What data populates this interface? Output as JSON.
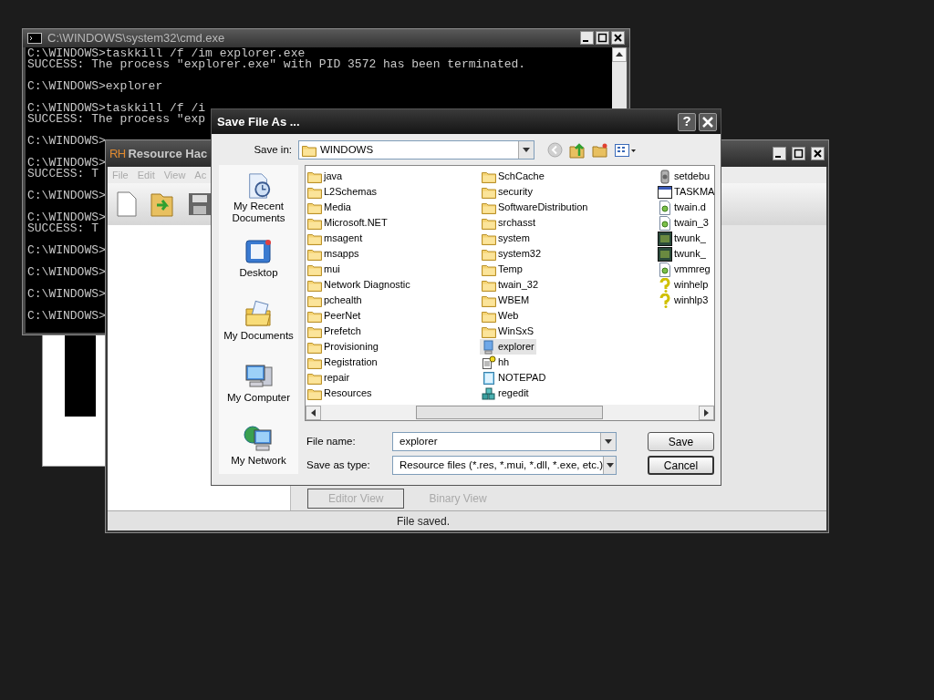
{
  "cmd_window": {
    "title": "C:\\WINDOWS\\system32\\cmd.exe",
    "blocks": [
      [
        "C:\\WINDOWS>taskkill /f /im explorer.exe",
        "SUCCESS: The process \"explorer.exe\" with PID 3572 has been terminated."
      ],
      [
        "C:\\WINDOWS>explorer"
      ],
      [
        "C:\\WINDOWS>taskkill /f /i",
        "SUCCESS: The process \"exp"
      ],
      [
        "C:\\WINDOWS>"
      ],
      [
        "C:\\WINDOWS>",
        "SUCCESS: T"
      ],
      [
        "C:\\WINDOWS>"
      ],
      [
        "C:\\WINDOWS>",
        "SUCCESS: T"
      ],
      [
        "C:\\WINDOWS>"
      ],
      [
        "C:\\WINDOWS>"
      ],
      [
        "C:\\WINDOWS>"
      ],
      [
        "C:\\WINDOWS>"
      ]
    ]
  },
  "resource_hacker": {
    "logo": "RH",
    "title": "Resource Hac",
    "menu": [
      "File",
      "Edit",
      "View",
      "Ac"
    ],
    "tabs": [
      {
        "label": "Editor View",
        "selected": true
      },
      {
        "label": "Binary View",
        "selected": false
      }
    ],
    "status": "File saved."
  },
  "save_dialog": {
    "title": "Save File As ...",
    "help_button": "?",
    "save_in": {
      "label": "Save in:",
      "value": "WINDOWS"
    },
    "places": [
      {
        "label": "My Recent Documents",
        "kind": "recent"
      },
      {
        "label": "Desktop",
        "kind": "desktop"
      },
      {
        "label": "My Documents",
        "kind": "documents"
      },
      {
        "label": "My Computer",
        "kind": "computer"
      },
      {
        "label": "My Network",
        "kind": "network"
      }
    ],
    "columns": [
      [
        {
          "name": "java",
          "kind": "folder",
          "selected": false
        },
        {
          "name": "L2Schemas",
          "kind": "folder",
          "selected": false
        },
        {
          "name": "Media",
          "kind": "folder",
          "selected": false
        },
        {
          "name": "Microsoft.NET",
          "kind": "folder",
          "selected": false
        },
        {
          "name": "msagent",
          "kind": "folder",
          "selected": false
        },
        {
          "name": "msapps",
          "kind": "folder",
          "selected": false
        },
        {
          "name": "mui",
          "kind": "folder",
          "selected": false
        },
        {
          "name": "Network Diagnostic",
          "kind": "folder",
          "selected": false
        },
        {
          "name": "pchealth",
          "kind": "folder",
          "selected": false
        },
        {
          "name": "PeerNet",
          "kind": "folder",
          "selected": false
        },
        {
          "name": "Prefetch",
          "kind": "folder",
          "selected": false
        },
        {
          "name": "Provisioning",
          "kind": "folder",
          "selected": false
        },
        {
          "name": "Registration",
          "kind": "folder",
          "selected": false
        },
        {
          "name": "repair",
          "kind": "folder",
          "selected": false
        },
        {
          "name": "Resources",
          "kind": "folder",
          "selected": false
        }
      ],
      [
        {
          "name": "SchCache",
          "kind": "folder",
          "selected": false
        },
        {
          "name": "security",
          "kind": "folder",
          "selected": false
        },
        {
          "name": "SoftwareDistribution",
          "kind": "folder",
          "selected": false
        },
        {
          "name": "srchasst",
          "kind": "folder",
          "selected": false
        },
        {
          "name": "system",
          "kind": "folder",
          "selected": false
        },
        {
          "name": "system32",
          "kind": "folder",
          "selected": false
        },
        {
          "name": "Temp",
          "kind": "folder",
          "selected": false
        },
        {
          "name": "twain_32",
          "kind": "folder",
          "selected": false
        },
        {
          "name": "WBEM",
          "kind": "folder",
          "selected": false
        },
        {
          "name": "Web",
          "kind": "folder",
          "selected": false
        },
        {
          "name": "WinSxS",
          "kind": "folder",
          "selected": false
        },
        {
          "name": "explorer",
          "kind": "computer",
          "selected": true
        },
        {
          "name": "hh",
          "kind": "helpdoc",
          "selected": false
        },
        {
          "name": "NOTEPAD",
          "kind": "notepad",
          "selected": false
        },
        {
          "name": "regedit",
          "kind": "registry",
          "selected": false
        }
      ],
      [
        {
          "name": "setdebu",
          "kind": "tool",
          "selected": false
        },
        {
          "name": "TASKMA",
          "kind": "window",
          "selected": false
        },
        {
          "name": "twain.d",
          "kind": "library",
          "selected": false
        },
        {
          "name": "twain_3",
          "kind": "library",
          "selected": false
        },
        {
          "name": "twunk_",
          "kind": "scanner",
          "selected": false
        },
        {
          "name": "twunk_",
          "kind": "scanner",
          "selected": false
        },
        {
          "name": "vmmreg",
          "kind": "library",
          "selected": false
        },
        {
          "name": "winhelp",
          "kind": "help",
          "selected": false
        },
        {
          "name": "winhlp3",
          "kind": "help",
          "selected": false
        }
      ]
    ],
    "file_name": {
      "label": "File name:",
      "value": "explorer"
    },
    "file_type": {
      "label": "Save as type:",
      "value": "Resource files (*.res, *.mui, *.dll, *.exe, etc.)"
    },
    "buttons": [
      "Save",
      "Cancel"
    ]
  }
}
